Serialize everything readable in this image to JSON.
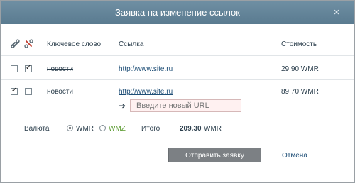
{
  "dialog": {
    "title": "Заявка на изменение ссылок",
    "close_glyph": "×"
  },
  "table": {
    "headers": {
      "keyword": "Ключевое слово",
      "link": "Ссылка",
      "cost": "Стоимость"
    },
    "rows": [
      {
        "checkbox_a": false,
        "checkbox_b": true,
        "keyword": "новости",
        "link": "http://www.site.ru",
        "cost": "29.90 WMR",
        "struck": true
      },
      {
        "checkbox_a": true,
        "checkbox_b": false,
        "keyword": "новости",
        "link": "http://www.site.ru",
        "cost": "89.70 WMR",
        "struck": false
      }
    ],
    "new_url_placeholder": "Введите новый URL"
  },
  "currency": {
    "label": "Валюта",
    "options": [
      "WMR",
      "WMZ"
    ],
    "selected": "WMR",
    "total_label": "Итого",
    "total_value": "209.30",
    "total_unit": "WMR"
  },
  "actions": {
    "send_label": "Отправить заявку",
    "cancel_label": "Отмена"
  },
  "colors": {
    "titlebar": "#5f7f94",
    "wmz": "#5a9a2e"
  },
  "icons": [
    "link-icon",
    "unlink-icon",
    "arrow-right-icon",
    "close-icon"
  ]
}
